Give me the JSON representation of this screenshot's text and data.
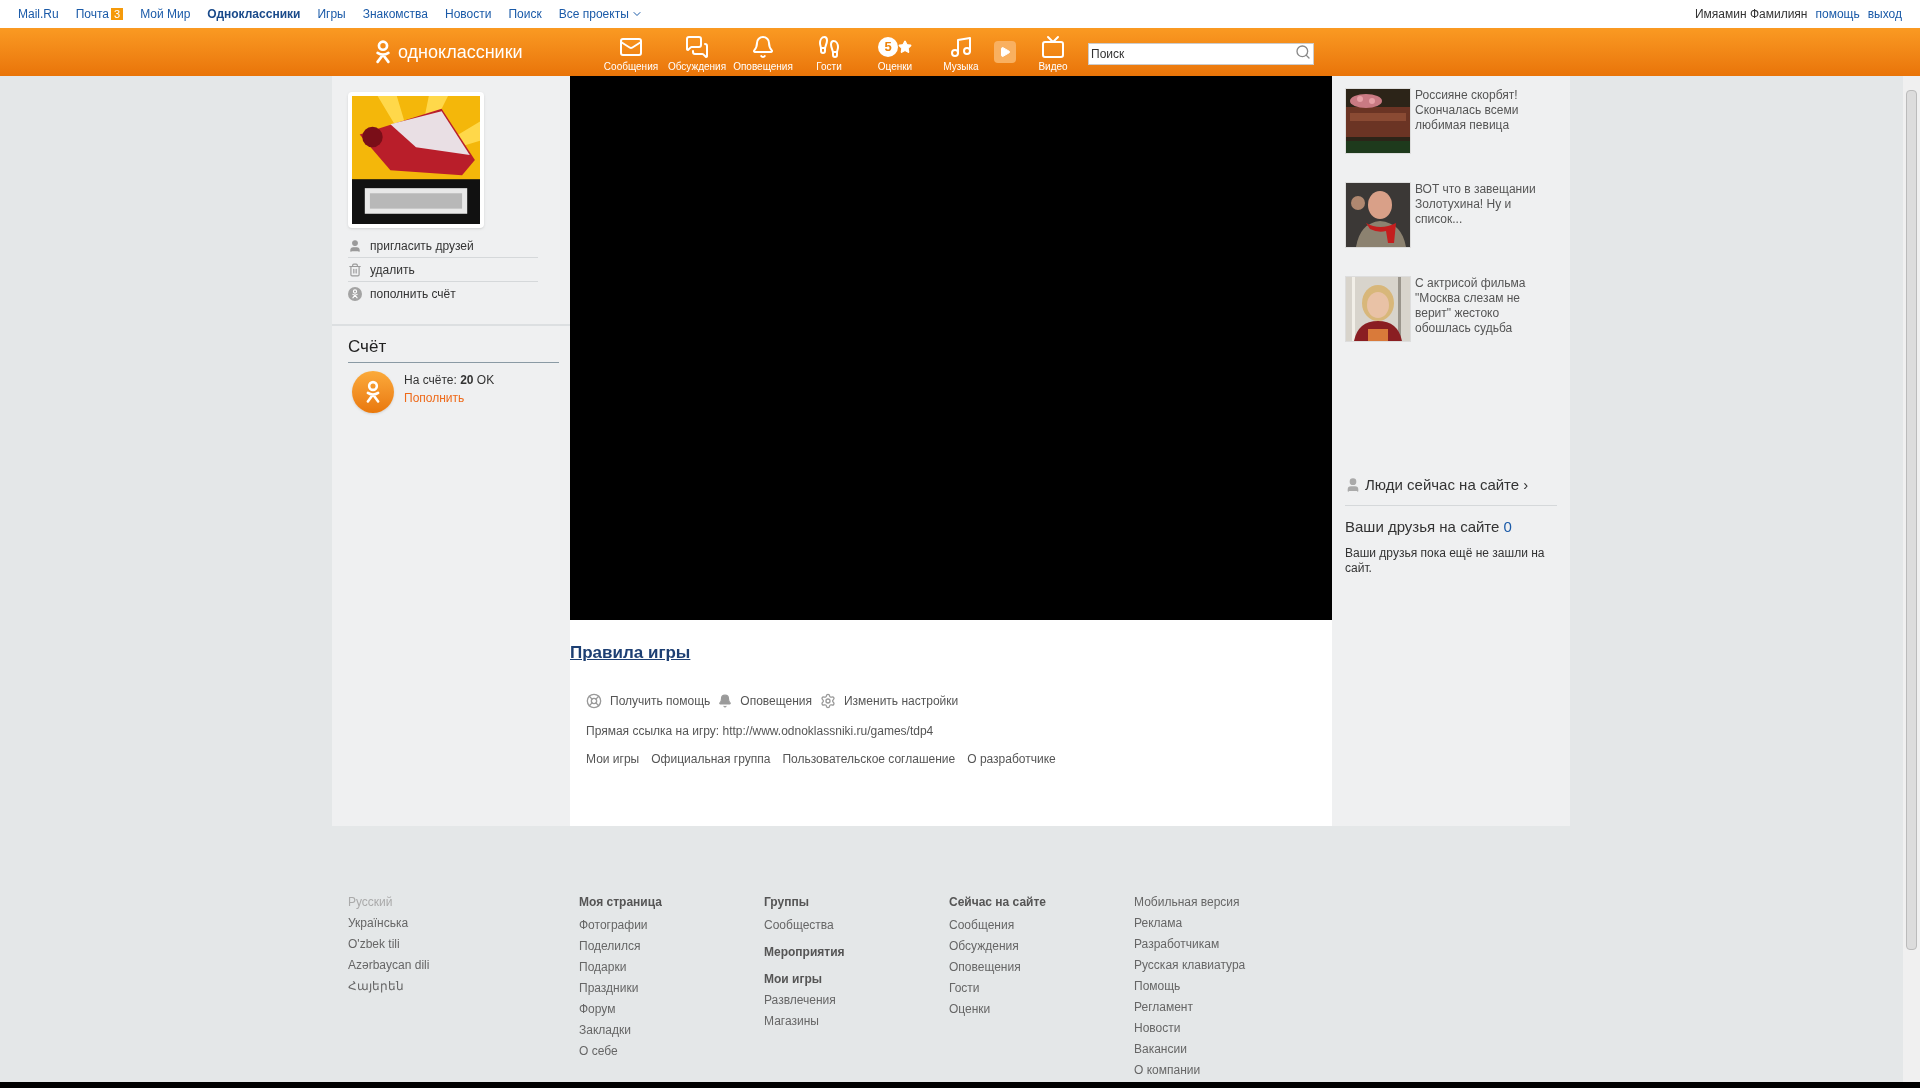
{
  "topbar": {
    "links": [
      {
        "label": "Mail.Ru",
        "selected": false
      },
      {
        "label": "Почта",
        "badge": "3",
        "selected": false
      },
      {
        "label": "Мой Мир",
        "selected": false
      },
      {
        "label": "Одноклассники",
        "selected": true
      },
      {
        "label": "Игры",
        "selected": false
      },
      {
        "label": "Знакомства",
        "selected": false
      },
      {
        "label": "Новости",
        "selected": false
      },
      {
        "label": "Поиск",
        "selected": false
      },
      {
        "label": "Все проекты",
        "kind": "dropdown",
        "selected": false
      }
    ],
    "user_name": "Имяамин Фамилиян",
    "user_links": [
      "помощь",
      "выход"
    ]
  },
  "navbar": {
    "logo": "одноклассники",
    "items": [
      {
        "label": "Сообщения",
        "kind": "mail"
      },
      {
        "label": "Обсуждения",
        "kind": "chat"
      },
      {
        "label": "Оповещения",
        "kind": "bell"
      },
      {
        "label": "Гости",
        "kind": "steps"
      },
      {
        "label": "Оценки",
        "kind": "rating",
        "badge": "5"
      },
      {
        "label": "Музыка",
        "kind": "music"
      },
      {
        "label": "Видео",
        "kind": "video"
      }
    ],
    "search": {
      "placeholder": "Поиск"
    }
  },
  "left": {
    "menu": [
      {
        "label": "пригласить друзей",
        "kind": "person"
      },
      {
        "label": "удалить",
        "kind": "trash"
      },
      {
        "label": "пополнить счёт",
        "kind": "coin"
      }
    ],
    "account": {
      "title": "Счёт",
      "balance": "На счёте: **20** OK",
      "topup": "Пополнить"
    }
  },
  "game": {
    "rules_link": "Правила игры",
    "actions": [
      {
        "label": "Получить помощь",
        "kind": "help"
      },
      {
        "label": "Оповещения",
        "kind": "bell"
      },
      {
        "label": "Изменить настройки",
        "kind": "settings"
      }
    ],
    "direct_link": "Прямая ссылка на игру: http://www.odnoklassniki.ru/games/tdp4",
    "links": [
      "Мои игры",
      "Официальная группа",
      "Пользовательское соглашение",
      "О разработчике"
    ]
  },
  "right": {
    "news": [
      {
        "text": "Россияне скорбят! Скончалась всеми любимая певица"
      },
      {
        "text": "ВОТ что в завещании Золотухина! Ну и список..."
      },
      {
        "text": "С актрисой фильма \"Москва слезам не верит\" жестоко обошлась судьба"
      }
    ],
    "people_online": "Люди сейчас на сайте ›",
    "friends_title": "Ваши друзья на сайте",
    "friends_count": "0",
    "friends_message": "Ваши друзья пока ещё не зашли на сайт."
  },
  "footer": {
    "columns": [
      {
        "items": [
          {
            "label": "Русский",
            "kind": "link",
            "selected": true
          },
          {
            "label": "Українська",
            "kind": "link",
            "selected": false
          },
          {
            "label": "O'zbek tili",
            "kind": "link",
            "selected": false
          },
          {
            "label": "Azərbaycan dili",
            "kind": "link",
            "selected": false
          },
          {
            "label": "Հայերեն",
            "kind": "link",
            "selected": false
          }
        ]
      },
      {
        "items": [
          {
            "label": "Моя страница",
            "kind": "heading"
          },
          {
            "label": "Фотографии",
            "kind": "link"
          },
          {
            "label": "Поделился",
            "kind": "link"
          },
          {
            "label": "Подарки",
            "kind": "link"
          },
          {
            "label": "Праздники",
            "kind": "link"
          },
          {
            "label": "Форум",
            "kind": "link"
          },
          {
            "label": "Закладки",
            "kind": "link"
          },
          {
            "label": "О себе",
            "kind": "link"
          }
        ]
      },
      {
        "items": [
          {
            "label": "Группы",
            "kind": "heading"
          },
          {
            "label": "Сообщества",
            "kind": "link"
          },
          {
            "label": "Мероприятия",
            "kind": "heading"
          },
          {
            "label": "Мои игры",
            "kind": "heading"
          },
          {
            "label": "Развлечения",
            "kind": "link"
          },
          {
            "label": "Магазины",
            "kind": "link"
          }
        ]
      },
      {
        "items": [
          {
            "label": "Сейчас на сайте",
            "kind": "heading"
          },
          {
            "label": "Сообщения",
            "kind": "link"
          },
          {
            "label": "Обсуждения",
            "kind": "link"
          },
          {
            "label": "Оповещения",
            "kind": "link"
          },
          {
            "label": "Гости",
            "kind": "link"
          },
          {
            "label": "Оценки",
            "kind": "link"
          }
        ]
      },
      {
        "items": [
          {
            "label": "Мобильная версия",
            "kind": "link"
          },
          {
            "label": "Реклама",
            "kind": "link"
          },
          {
            "label": "Разработчикам",
            "kind": "link"
          },
          {
            "label": "Русская клавиатура",
            "kind": "link"
          },
          {
            "label": "Помощь",
            "kind": "link"
          },
          {
            "label": "Регламент",
            "kind": "link"
          },
          {
            "label": "Новости",
            "kind": "link"
          },
          {
            "label": "Вакансии",
            "kind": "link"
          },
          {
            "label": "О компании",
            "kind": "link"
          }
        ]
      }
    ]
  }
}
